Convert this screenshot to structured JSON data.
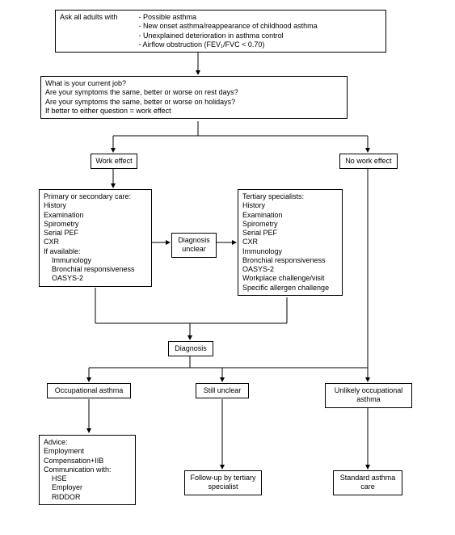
{
  "box1": {
    "lead": "Ask all adults with",
    "items": [
      "- Possible asthma",
      "- New onset asthma/reappearance of childhood asthma",
      "- Unexplained deterioration in asthma control",
      "- Airflow obstruction (FEV₁/FVC < 0.70)"
    ]
  },
  "box2": {
    "lines": [
      "What is your current job?",
      "Are your symptoms the same, better or worse on rest days?",
      "Are your symptoms the same, better or worse on holidays?",
      "If better to either question = work effect"
    ]
  },
  "work_effect": "Work effect",
  "no_work_effect": "No work effect",
  "primary": {
    "title": "Primary or secondary care:",
    "items": [
      "History",
      "Examination",
      "Spirometry",
      "Serial PEF",
      "CXR"
    ],
    "avail": "If available:",
    "avail_items": [
      "Immunology",
      "Bronchial responsiveness",
      "OASYS-2"
    ]
  },
  "diag_unclear": "Diagnosis unclear",
  "tertiary": {
    "title": "Tertiary specialists:",
    "items": [
      "History",
      "Examination",
      "Spirometry",
      "Serial PEF",
      "CXR",
      "Immunology",
      "Bronchial responsiveness",
      "OASYS-2",
      "Workplace challenge/visit",
      "Specific allergen challenge"
    ]
  },
  "diagnosis": "Diagnosis",
  "occ_asthma": "Occupational asthma",
  "still_unclear": "Still unclear",
  "unlikely": "Unlikely occupational asthma",
  "advice": {
    "lines": [
      "Advice:",
      "Employment",
      "Compensation+IIB",
      "Communication with:"
    ],
    "sub": [
      "HSE",
      "Employer",
      "RIDDOR"
    ]
  },
  "followup": "Follow-up by tertiary specialist",
  "standard": "Standard asthma care"
}
